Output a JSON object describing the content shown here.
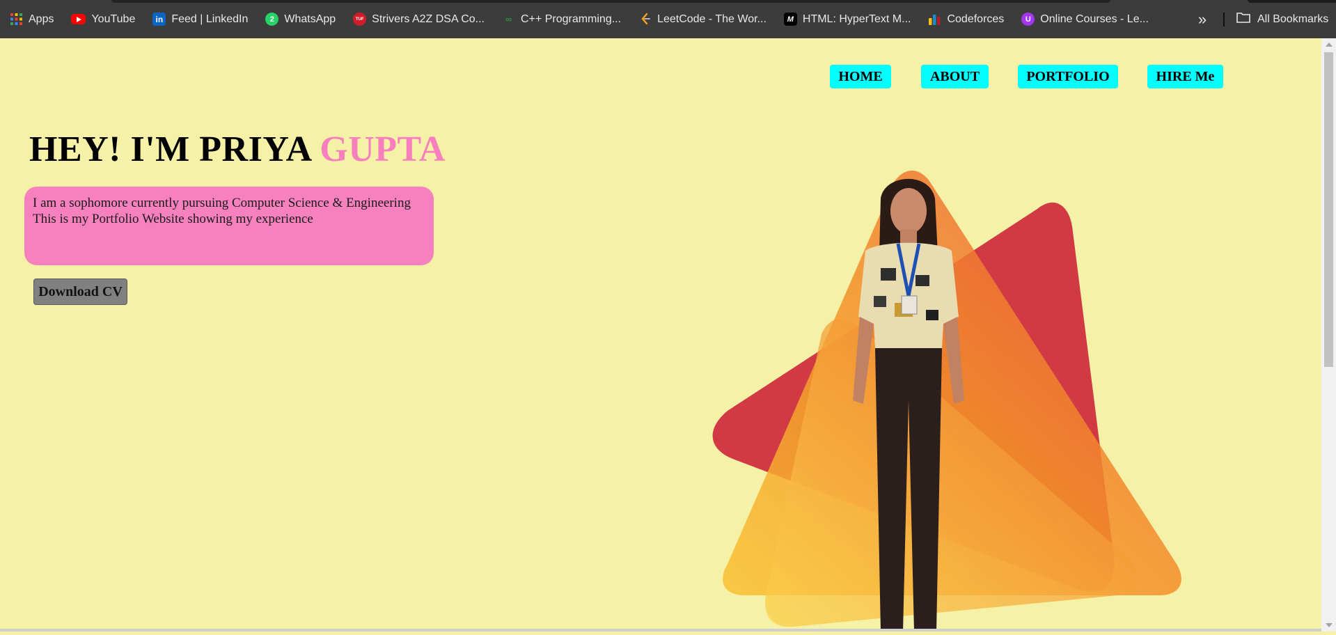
{
  "bookmarks": {
    "items": [
      {
        "label": "Apps",
        "icon": "apps-grid-icon",
        "color": "#ea4335"
      },
      {
        "label": "YouTube",
        "icon": "youtube-icon",
        "color": "#ff0000"
      },
      {
        "label": "Feed | LinkedIn",
        "icon": "linkedin-icon",
        "color": "#0a66c2"
      },
      {
        "label": "WhatsApp",
        "icon": "whatsapp-icon",
        "color": "#25d366"
      },
      {
        "label": "Strivers A2Z DSA Co...",
        "icon": "takeuforward-icon",
        "color": "#d01c2a"
      },
      {
        "label": "C++ Programming...",
        "icon": "geeksforgeeks-icon",
        "color": "#2f8d46"
      },
      {
        "label": "LeetCode - The Wor...",
        "icon": "leetcode-icon",
        "color": "#ffa116"
      },
      {
        "label": "HTML: HyperText M...",
        "icon": "mdn-icon",
        "color": "#000000"
      },
      {
        "label": "Codeforces",
        "icon": "codeforces-icon",
        "color": "#1f8acb"
      },
      {
        "label": "Online Courses - Le...",
        "icon": "udemy-icon",
        "color": "#a435f0"
      }
    ],
    "all_label": "All Bookmarks"
  },
  "nav": {
    "home": "HOME",
    "about": "ABOUT",
    "portfolio": "PORTFOLIO",
    "hire": "HIRE Me"
  },
  "hero": {
    "title_main": "HEY! I'M PRIYA ",
    "title_accent": "GUPTA",
    "line1": "I am a sophomore currently pursuing Computer Science & Engineering",
    "line2": "This is my Portfolio Website showing my experience",
    "cv_button": "Download CV"
  },
  "colors": {
    "page_bg": "#f5f1a6",
    "accent_pink": "#f77fbe",
    "nav_cyan": "#00ffff"
  }
}
